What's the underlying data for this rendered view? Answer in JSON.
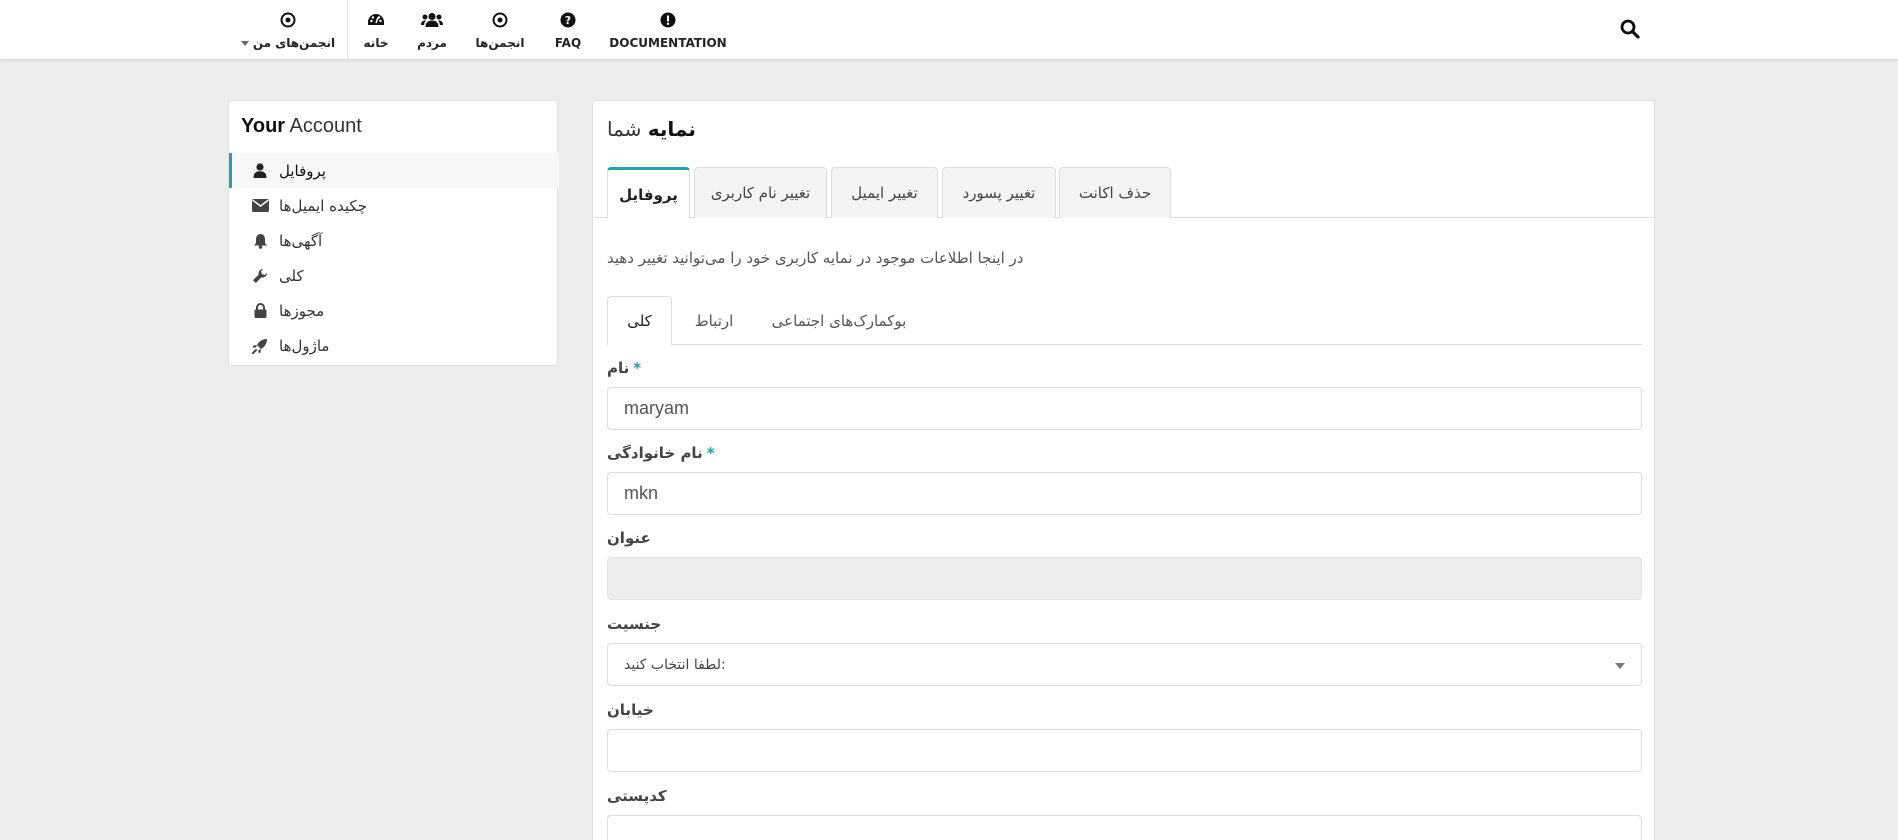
{
  "nav": {
    "items": [
      {
        "key": "my-spaces",
        "label": "انجمن‌های من",
        "icon": "dot-circle-icon"
      },
      {
        "key": "home",
        "label": "خانه",
        "icon": "dashboard-icon"
      },
      {
        "key": "people",
        "label": "مردم",
        "icon": "users-icon"
      },
      {
        "key": "spaces",
        "label": "انجمن‌ها",
        "icon": "dot-circle-icon"
      },
      {
        "key": "faq",
        "label": "FAQ",
        "icon": "question-circle-icon"
      },
      {
        "key": "documentation",
        "label": "DOCUMENTATION",
        "icon": "exclamation-circle-icon"
      }
    ],
    "search_icon": "search-icon"
  },
  "account": {
    "title_bold": "Your",
    "title_rest": " Account",
    "menu": [
      {
        "label": "پروفایل",
        "icon": "user-icon",
        "active": true
      },
      {
        "label": "چکیده ایمیل‌ها",
        "icon": "envelope-icon",
        "active": false
      },
      {
        "label": "آگهی‌ها",
        "icon": "bell-icon",
        "active": false
      },
      {
        "label": "کلی",
        "icon": "wrench-icon",
        "active": false
      },
      {
        "label": "مجوزها",
        "icon": "lock-icon",
        "active": false
      },
      {
        "label": "ماژول‌ها",
        "icon": "rocket-icon",
        "active": false
      }
    ]
  },
  "panel": {
    "title_bold": "نمایه",
    "title_rest": " شما",
    "tabs": [
      {
        "label": "پروفایل",
        "active": true
      },
      {
        "label": "تغییر نام کاربری",
        "active": false
      },
      {
        "label": "تغییر ایمیل",
        "active": false
      },
      {
        "label": "تغییر پسورد",
        "active": false
      },
      {
        "label": "حذف اکانت",
        "active": false
      }
    ],
    "info": "در اینجا اطلاعات موجود در نمایه کاربری خود را می‌توانید تغییر دهید",
    "subtabs": [
      {
        "label": "کلی",
        "active": true
      },
      {
        "label": "ارتباط",
        "active": false
      },
      {
        "label": "بوکمارک‌های اجتماعی",
        "active": false
      }
    ],
    "fields": {
      "firstname": {
        "label": "نام",
        "required_mark": "*",
        "value": "maryam"
      },
      "lastname": {
        "label": "نام خانوادگی",
        "required_mark": "*",
        "value": "mkn"
      },
      "title": {
        "label": "عنوان",
        "value": ""
      },
      "gender": {
        "label": "جنسیت",
        "selected": "لطفا انتخاب کنید:"
      },
      "street": {
        "label": "خیابان",
        "value": ""
      },
      "zip": {
        "label": "کدپستی",
        "value": ""
      }
    }
  },
  "colors": {
    "accent": "#21a1b3",
    "background": "#ededed"
  }
}
